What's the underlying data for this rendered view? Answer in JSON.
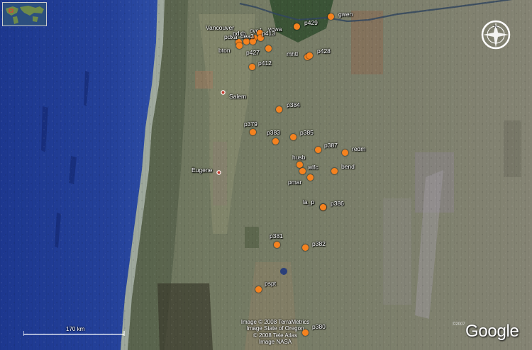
{
  "map": {
    "stations": [
      {
        "id": "pdxb"
      },
      {
        "id": "cvo1"
      },
      {
        "id": "vcwa"
      },
      {
        "id": "dea3"
      },
      {
        "id": "p413"
      },
      {
        "id": "pdxa"
      },
      {
        "id": "bton"
      },
      {
        "id": "p427"
      },
      {
        "id": "p412"
      },
      {
        "id": "p429"
      },
      {
        "id": "gwen"
      },
      {
        "id": "mhtl"
      },
      {
        "id": "p428"
      },
      {
        "id": "p384"
      },
      {
        "id": "p379"
      },
      {
        "id": "p383"
      },
      {
        "id": "p385"
      },
      {
        "id": "p387"
      },
      {
        "id": "redm"
      },
      {
        "id": "husb"
      },
      {
        "id": "wlfc"
      },
      {
        "id": "bend"
      },
      {
        "id": "pmar"
      },
      {
        "id": "la_p"
      },
      {
        "id": "p386"
      },
      {
        "id": "p381"
      },
      {
        "id": "p382"
      },
      {
        "id": "pspt"
      },
      {
        "id": "p380"
      }
    ],
    "cities": [
      {
        "name": "Vancouver"
      },
      {
        "name": "Salem"
      },
      {
        "name": "Eugene"
      }
    ],
    "station_color": "#f5821f",
    "city_marker_color": "#c0392b",
    "ocean_color": "#1f3a8f"
  },
  "scale": {
    "label": "170 km"
  },
  "credits": {
    "lines": [
      "Image © 2008 TerraMetrics",
      "Image State of Oregon",
      "© 2008 Tele Atlas",
      "Image NASA"
    ]
  },
  "logo": {
    "word": "Google",
    "year": "©2007"
  },
  "icons": {
    "compass": "compass-icon",
    "overview": "overview-map-icon"
  }
}
